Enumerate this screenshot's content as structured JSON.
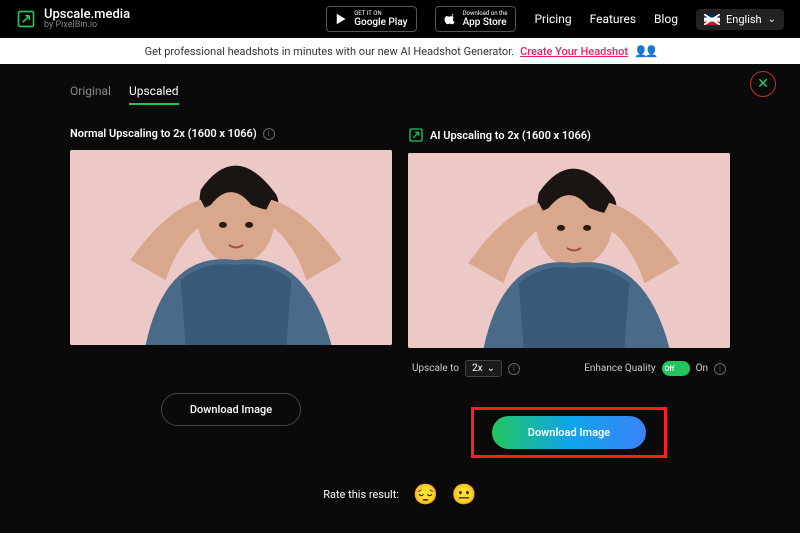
{
  "header": {
    "brand": "Upscale.media",
    "brand_sub": "by PixelBin.io",
    "store_google_top": "GET IT ON",
    "store_google_bottom": "Google Play",
    "store_apple_top": "Download on the",
    "store_apple_bottom": "App Store",
    "nav_pricing": "Pricing",
    "nav_features": "Features",
    "nav_blog": "Blog",
    "lang_label": "English"
  },
  "banner": {
    "text": "Get professional headshots in minutes with our new AI Headshot Generator.",
    "link": "Create Your Headshot"
  },
  "tabs": {
    "original": "Original",
    "upscaled": "Upscaled"
  },
  "left_panel": {
    "title": "Normal Upscaling to 2x (1600 x 1066)",
    "download": "Download Image"
  },
  "right_panel": {
    "title": "AI Upscaling to 2x (1600 x 1066)",
    "upscale_to_label": "Upscale to",
    "upscale_value": "2x",
    "enhance_label": "Enhance Quality",
    "toggle_off": "Off",
    "toggle_on": "On",
    "download": "Download Image"
  },
  "rate": {
    "label": "Rate this result:"
  }
}
